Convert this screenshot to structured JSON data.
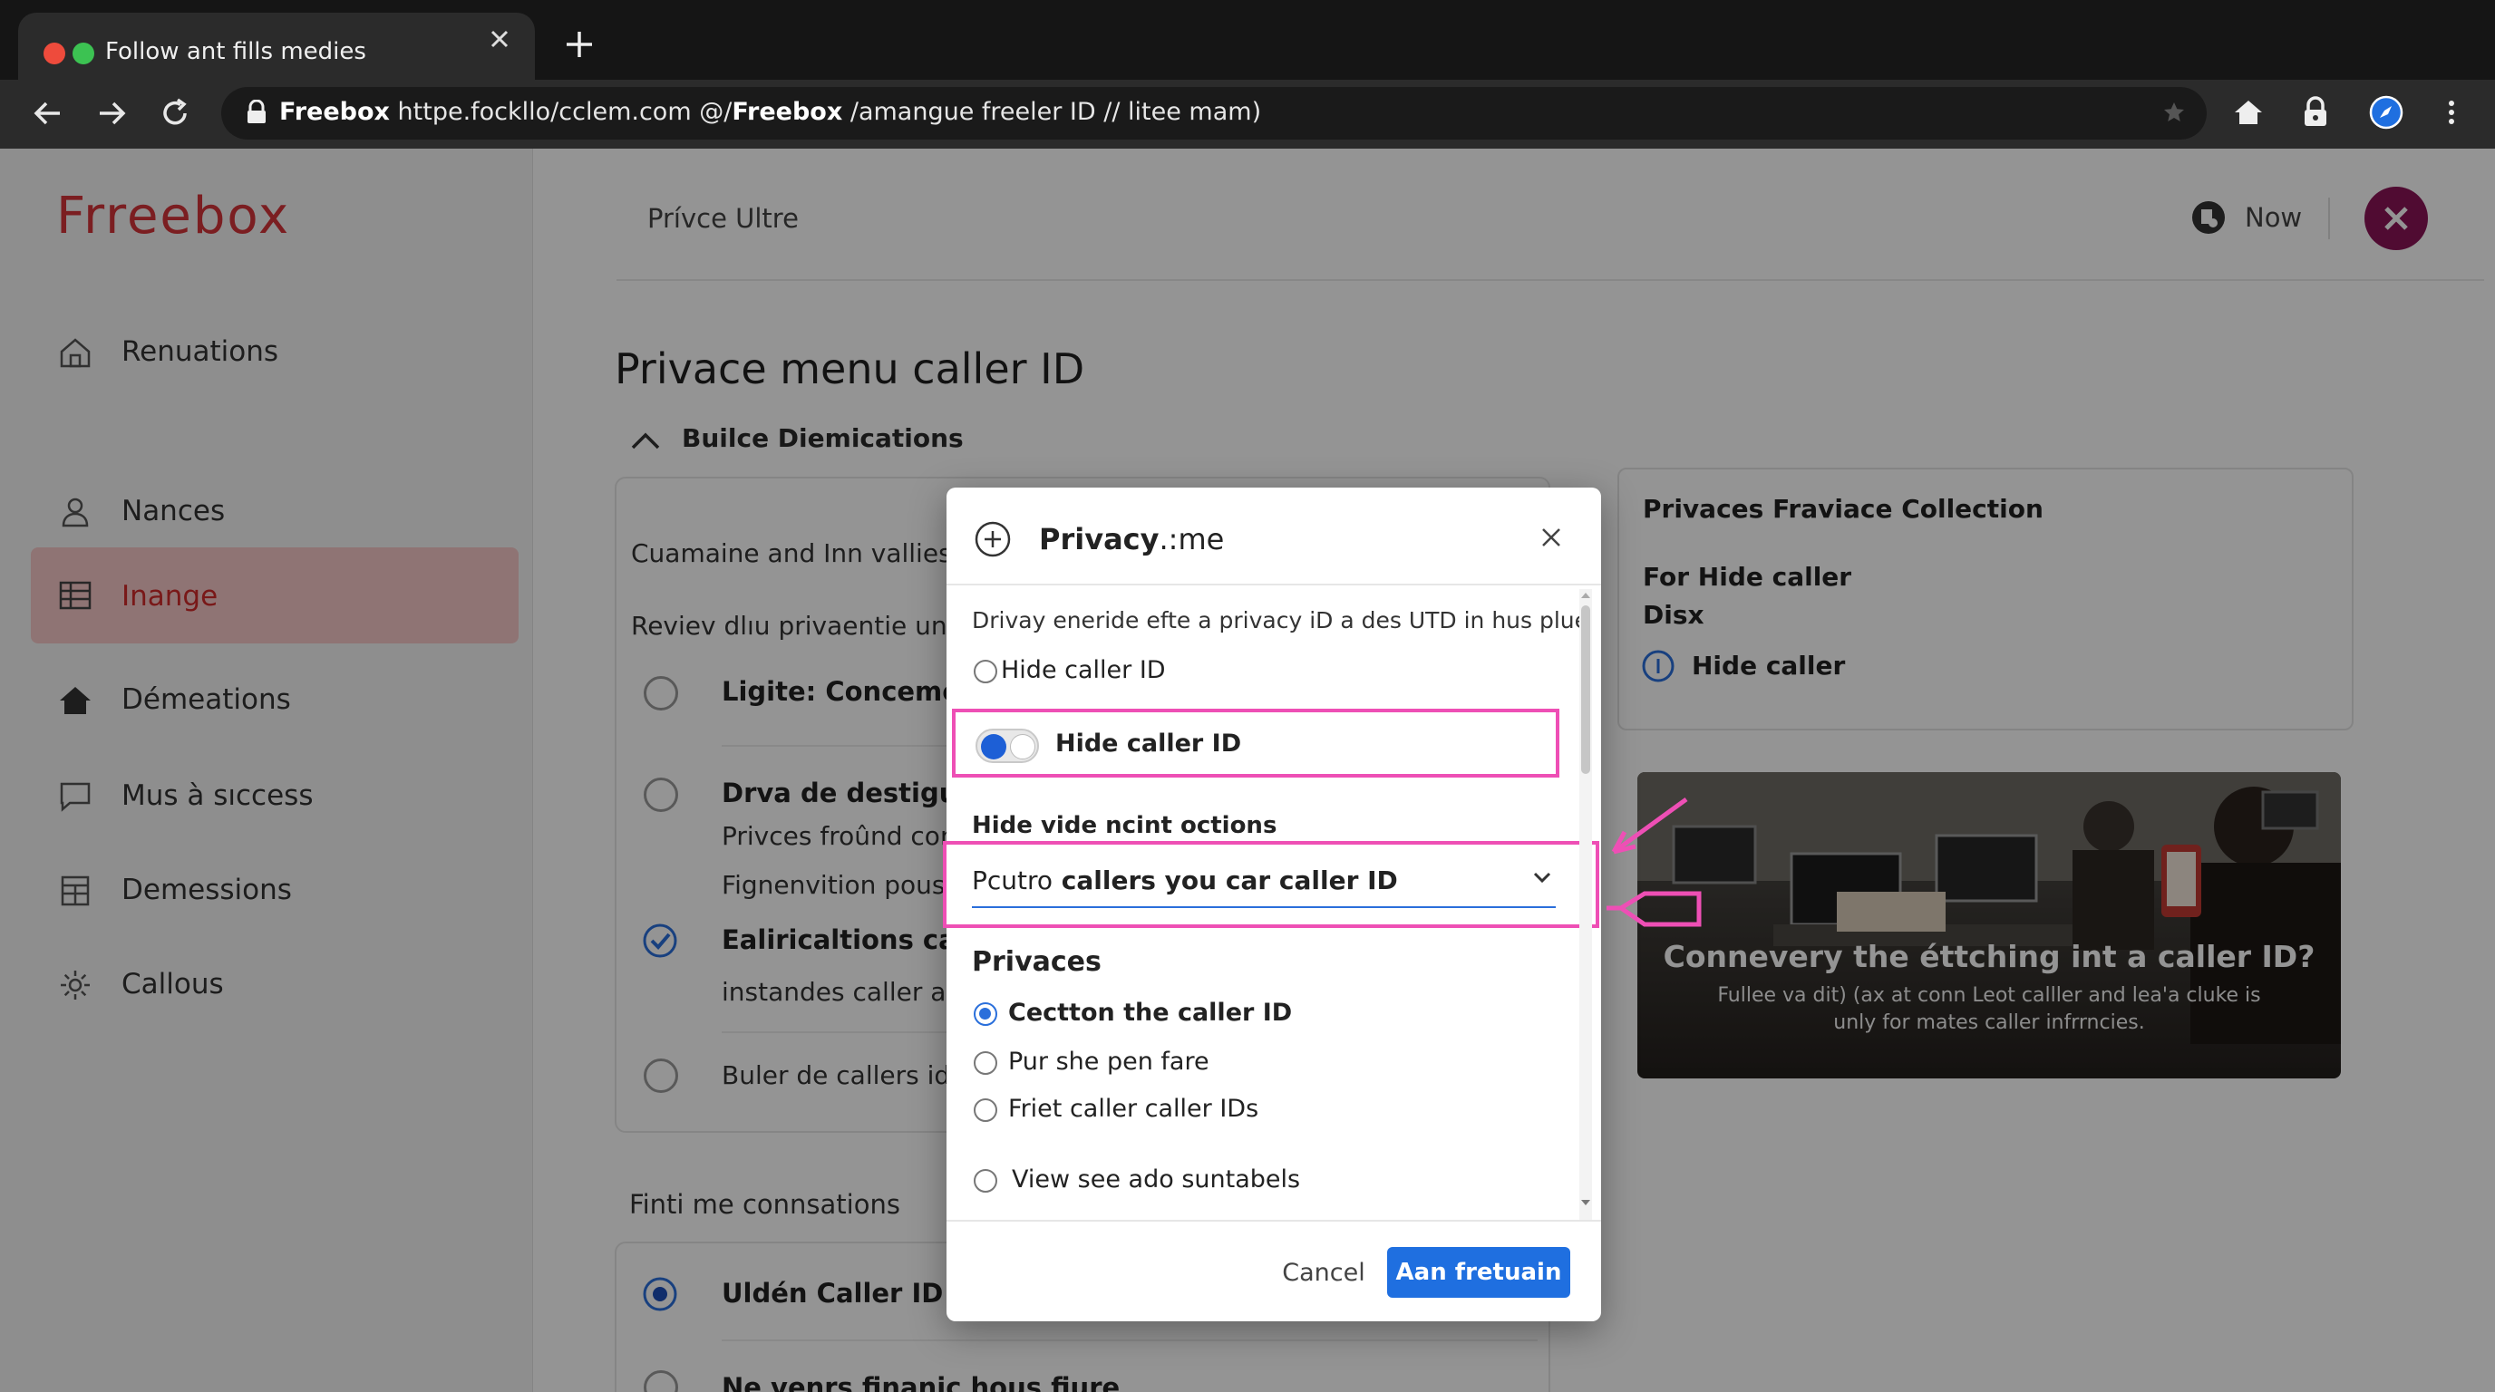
{
  "browser": {
    "tab_title": "Follow ant fills medies",
    "url_host": "Freebox",
    "url_mid": " httpe.fockllo/cclem.com @/",
    "url_bold2": "Freebox",
    "url_tail": " ∕amangue freeler ID // litee mam)"
  },
  "sidebar": {
    "logo": "Frreebox",
    "items": [
      {
        "label": "Renuations",
        "icon": "home-icon"
      },
      {
        "label": "Nances",
        "icon": "user-icon"
      },
      {
        "label": "Inange",
        "icon": "list-icon",
        "active": true
      },
      {
        "label": "Démeations",
        "icon": "house-filled-icon"
      },
      {
        "label": "Mus à sıccess",
        "icon": "chat-icon"
      },
      {
        "label": "Demessions",
        "icon": "table-icon"
      },
      {
        "label": "Callous",
        "icon": "gear-icon"
      }
    ]
  },
  "header": {
    "title": "Prívce Ultre",
    "now_label": "Now"
  },
  "main": {
    "page_title": "Privace menu caller ID",
    "section_title": "Builce Diemications",
    "card_intro": "Cuamaine and Inn vallies..",
    "card_sub": "Reviev dlıu privaentie un clc",
    "rows": [
      {
        "title": "Ligite: Concemenc",
        "sub": ""
      },
      {
        "title": "Drva de destigus ı:",
        "sub": "Privces froûnd conn"
      },
      {
        "title": "",
        "sub": "Fignenvition pouse"
      },
      {
        "title": "Ealiricaltions catio",
        "sub": "instandes caller ato"
      },
      {
        "title": "Buler de callers idı",
        "sub": ""
      }
    ],
    "section2_title": "Finti me connsations",
    "section2_row": "Uldén Caller ID fon",
    "section2_row2": "Ne venrs finanic hous fiure"
  },
  "right_card": {
    "title": "Privaces Fraviace Collection",
    "line1": "For Hide caller",
    "line2": "Disx",
    "info_label": "Hide caller"
  },
  "promo": {
    "title": "Connevery the éttching int a caller ID?",
    "desc": "Fullee va dit) (ax at conn Leot calller and lea'a cluke is unly for mates caller infrrncies."
  },
  "modal": {
    "title_bold": "Privacy",
    "title_rest": ".:me",
    "desc": "Drivay eneride efte a privacy iD a des UTD in hus plue",
    "radio_hide_label": "Hide caller ID",
    "toggle_label": "Hide caller ID",
    "toggle_on": true,
    "subhead": "Hide vide ncint octions",
    "select_prefix": "Pcutro",
    "select_rest": " callers you car caller ID",
    "group_title": "Privaces",
    "options": [
      {
        "label": "Cectton the caller ID",
        "selected": true
      },
      {
        "label": "Pur she pen fare",
        "selected": false
      },
      {
        "label": "Friet caller  caller IDs",
        "selected": false
      },
      {
        "label": "View see ado suntabels",
        "selected": false
      }
    ],
    "cancel_label": "Cancel",
    "confirm_label": "Aan fretuain"
  },
  "colors": {
    "brand_red": "#d4343a",
    "highlight_pink": "#ee4fb5",
    "primary_blue": "#1f6fe0",
    "close_purple": "#8a1457"
  }
}
